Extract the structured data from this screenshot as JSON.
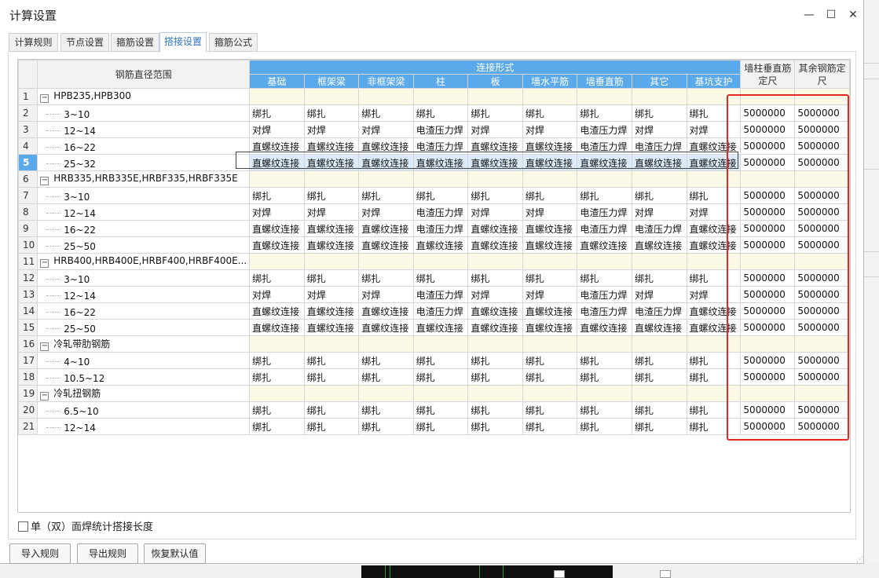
{
  "window": {
    "title": "计算设置",
    "minimize": "—",
    "maximize": "☐",
    "close": "✕"
  },
  "tabs": [
    {
      "label": "计算规则",
      "active": false
    },
    {
      "label": "节点设置",
      "active": false
    },
    {
      "label": "箍筋设置",
      "active": false
    },
    {
      "label": "搭接设置",
      "active": true
    },
    {
      "label": "箍筋公式",
      "active": false
    }
  ],
  "grid": {
    "header_range": "钢筋直径范围",
    "header_group": "连接形式",
    "columns": [
      "基础",
      "框架梁",
      "非框架梁",
      "柱",
      "板",
      "墙水平筋",
      "墙垂直筋",
      "其它",
      "基坑支护"
    ],
    "header_wall_vertical_1": "墙柱垂直筋",
    "header_wall_vertical_2": "定尺",
    "header_other_1": "其余钢筋定",
    "header_other_2": "尺",
    "selected_row": 5,
    "rows": [
      {
        "num": "1",
        "type": "group",
        "label": "HPB235,HPB300"
      },
      {
        "num": "2",
        "type": "item",
        "label": "3~10",
        "values": [
          "绑扎",
          "绑扎",
          "绑扎",
          "绑扎",
          "绑扎",
          "绑扎",
          "绑扎",
          "绑扎",
          "绑扎"
        ],
        "len1": "5000000",
        "len2": "5000000"
      },
      {
        "num": "3",
        "type": "item",
        "label": "12~14",
        "values": [
          "对焊",
          "对焊",
          "对焊",
          "电渣压力焊",
          "对焊",
          "对焊",
          "电渣压力焊",
          "对焊",
          "对焊"
        ],
        "len1": "5000000",
        "len2": "5000000"
      },
      {
        "num": "4",
        "type": "item",
        "label": "16~22",
        "values": [
          "直螺纹连接",
          "直螺纹连接",
          "直螺纹连接",
          "电渣压力焊",
          "直螺纹连接",
          "直螺纹连接",
          "电渣压力焊",
          "电渣压力焊",
          "直螺纹连接"
        ],
        "len1": "5000000",
        "len2": "5000000"
      },
      {
        "num": "5",
        "type": "item",
        "label": "25~32",
        "values": [
          "直螺纹连接",
          "直螺纹连接",
          "直螺纹连接",
          "直螺纹连接",
          "直螺纹连接",
          "直螺纹连接",
          "直螺纹连接",
          "直螺纹连接",
          "直螺纹连接"
        ],
        "len1": "5000000",
        "len2": "5000000"
      },
      {
        "num": "6",
        "type": "group",
        "label": "HRB335,HRB335E,HRBF335,HRBF335E"
      },
      {
        "num": "7",
        "type": "item",
        "label": "3~10",
        "values": [
          "绑扎",
          "绑扎",
          "绑扎",
          "绑扎",
          "绑扎",
          "绑扎",
          "绑扎",
          "绑扎",
          "绑扎"
        ],
        "len1": "5000000",
        "len2": "5000000"
      },
      {
        "num": "8",
        "type": "item",
        "label": "12~14",
        "values": [
          "对焊",
          "对焊",
          "对焊",
          "电渣压力焊",
          "对焊",
          "对焊",
          "电渣压力焊",
          "对焊",
          "对焊"
        ],
        "len1": "5000000",
        "len2": "5000000"
      },
      {
        "num": "9",
        "type": "item",
        "label": "16~22",
        "values": [
          "直螺纹连接",
          "直螺纹连接",
          "直螺纹连接",
          "电渣压力焊",
          "直螺纹连接",
          "直螺纹连接",
          "电渣压力焊",
          "电渣压力焊",
          "直螺纹连接"
        ],
        "len1": "5000000",
        "len2": "5000000"
      },
      {
        "num": "10",
        "type": "item",
        "label": "25~50",
        "values": [
          "直螺纹连接",
          "直螺纹连接",
          "直螺纹连接",
          "直螺纹连接",
          "直螺纹连接",
          "直螺纹连接",
          "直螺纹连接",
          "直螺纹连接",
          "直螺纹连接"
        ],
        "len1": "5000000",
        "len2": "5000000"
      },
      {
        "num": "11",
        "type": "group",
        "label": "HRB400,HRB400E,HRBF400,HRBF400E..."
      },
      {
        "num": "12",
        "type": "item",
        "label": "3~10",
        "values": [
          "绑扎",
          "绑扎",
          "绑扎",
          "绑扎",
          "绑扎",
          "绑扎",
          "绑扎",
          "绑扎",
          "绑扎"
        ],
        "len1": "5000000",
        "len2": "5000000"
      },
      {
        "num": "13",
        "type": "item",
        "label": "12~14",
        "values": [
          "对焊",
          "对焊",
          "对焊",
          "电渣压力焊",
          "对焊",
          "对焊",
          "电渣压力焊",
          "对焊",
          "对焊"
        ],
        "len1": "5000000",
        "len2": "5000000"
      },
      {
        "num": "14",
        "type": "item",
        "label": "16~22",
        "values": [
          "直螺纹连接",
          "直螺纹连接",
          "直螺纹连接",
          "电渣压力焊",
          "直螺纹连接",
          "直螺纹连接",
          "电渣压力焊",
          "电渣压力焊",
          "直螺纹连接"
        ],
        "len1": "5000000",
        "len2": "5000000"
      },
      {
        "num": "15",
        "type": "item",
        "label": "25~50",
        "values": [
          "直螺纹连接",
          "直螺纹连接",
          "直螺纹连接",
          "直螺纹连接",
          "直螺纹连接",
          "直螺纹连接",
          "直螺纹连接",
          "直螺纹连接",
          "直螺纹连接"
        ],
        "len1": "5000000",
        "len2": "5000000"
      },
      {
        "num": "16",
        "type": "group",
        "label": "冷轧带肋钢筋"
      },
      {
        "num": "17",
        "type": "item",
        "label": "4~10",
        "values": [
          "绑扎",
          "绑扎",
          "绑扎",
          "绑扎",
          "绑扎",
          "绑扎",
          "绑扎",
          "绑扎",
          "绑扎"
        ],
        "len1": "5000000",
        "len2": "5000000"
      },
      {
        "num": "18",
        "type": "item",
        "label": "10.5~12",
        "values": [
          "绑扎",
          "绑扎",
          "绑扎",
          "绑扎",
          "绑扎",
          "绑扎",
          "绑扎",
          "绑扎",
          "绑扎"
        ],
        "len1": "5000000",
        "len2": "5000000"
      },
      {
        "num": "19",
        "type": "group",
        "label": "冷轧扭钢筋"
      },
      {
        "num": "20",
        "type": "item",
        "label": "6.5~10",
        "values": [
          "绑扎",
          "绑扎",
          "绑扎",
          "绑扎",
          "绑扎",
          "绑扎",
          "绑扎",
          "绑扎",
          "绑扎"
        ],
        "len1": "5000000",
        "len2": "5000000"
      },
      {
        "num": "21",
        "type": "item",
        "label": "12~14",
        "values": [
          "绑扎",
          "绑扎",
          "绑扎",
          "绑扎",
          "绑扎",
          "绑扎",
          "绑扎",
          "绑扎",
          "绑扎"
        ],
        "len1": "5000000",
        "len2": "5000000"
      }
    ]
  },
  "footer": {
    "checkbox_label": "单（双）面焊统计搭接长度",
    "import_button": "导入规则",
    "export_button": "导出规则",
    "restore_button": "恢复默认值"
  },
  "colors": {
    "header_blue": "#5aa9ea",
    "group_row": "#fcf9e6",
    "highlight_box": "#e32a22",
    "active_tab": "#2e75c5"
  }
}
